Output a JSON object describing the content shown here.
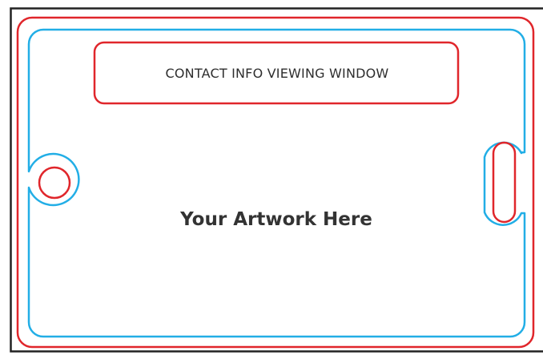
{
  "template": {
    "window_label": "CONTACT INFO VIEWING WINDOW",
    "artwork_label": "Your Artwork Here"
  },
  "colors": {
    "frame": "#222222",
    "cut_line": "#e0262b",
    "safe_line": "#22aee6",
    "text": "#333333",
    "background": "#ffffff"
  }
}
